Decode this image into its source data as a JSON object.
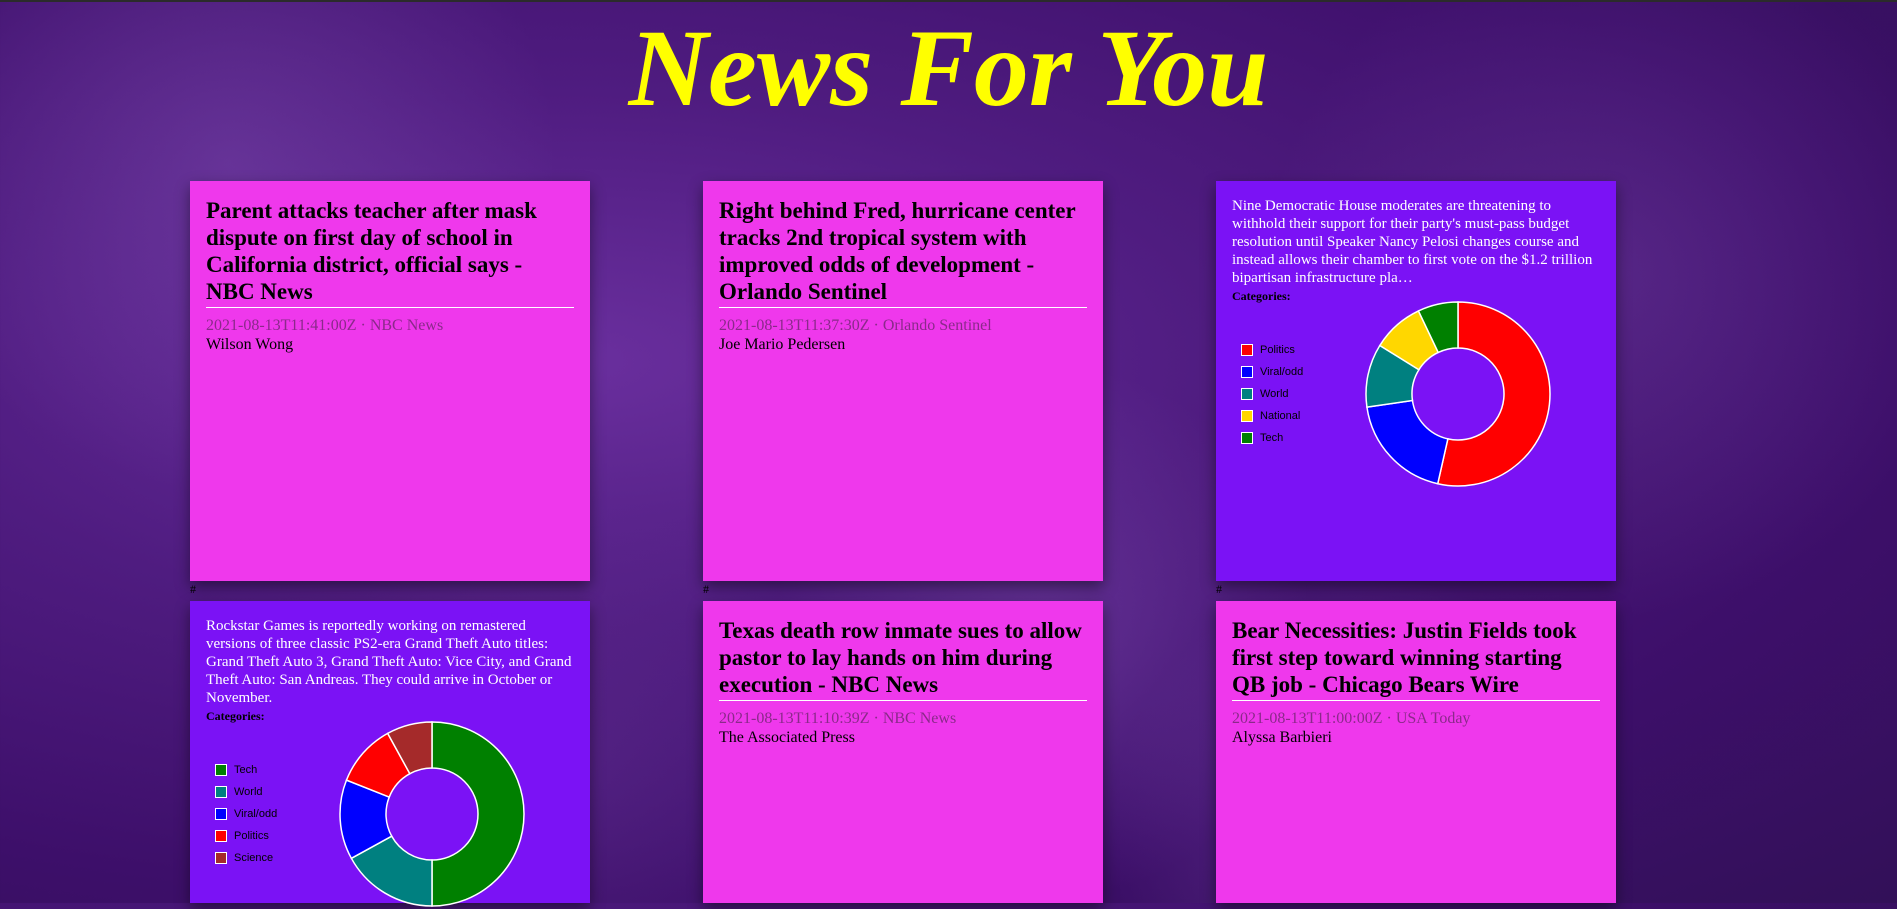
{
  "site": {
    "title": "News For You"
  },
  "cards": [
    {
      "type": "article",
      "headline": "Parent attacks teacher after mask dispute on first day of school in California district, official says - NBC News",
      "meta": "2021-08-13T11:41:00Z · NBC News",
      "author": "Wilson Wong"
    },
    {
      "type": "article",
      "headline": "Right behind Fred, hurricane center tracks 2nd tropical system with improved odds of development - Orlando Sentinel",
      "meta": "2021-08-13T11:37:30Z · Orlando Sentinel",
      "author": "Joe Mario Pedersen"
    },
    {
      "type": "summary",
      "summary": "Nine Democratic House moderates are threatening to withhold their support for their party's must-pass budget resolution until Speaker Nancy Pelosi changes course and instead allows their chamber to first vote on the $1.2 trillion bipartisan infrastructure pla…",
      "categories_label": "Categories:"
    },
    {
      "type": "summary",
      "summary": "Rockstar Games is reportedly working on remastered versions of three classic PS2-era Grand Theft Auto titles: Grand Theft Auto 3, Grand Theft Auto: Vice City, and Grand Theft Auto: San Andreas. They could arrive in October or November.",
      "categories_label": "Categories:"
    },
    {
      "type": "article",
      "headline": "Texas death row inmate sues to allow pastor to lay hands on him during execution - NBC News",
      "meta": "2021-08-13T11:10:39Z · NBC News",
      "author": "The Associated Press"
    },
    {
      "type": "article",
      "headline": "Bear Necessities: Justin Fields took first step toward winning starting QB job - Chicago Bears Wire",
      "meta": "2021-08-13T11:00:00Z · USA Today",
      "author": "Alyssa Barbieri"
    }
  ],
  "separators": [
    "#",
    "#",
    "#"
  ],
  "chart_data": [
    {
      "type": "pie",
      "donut": true,
      "legend_position": "left",
      "categories": [
        "Politics",
        "Viral/odd",
        "World",
        "National",
        "Tech"
      ],
      "values": [
        53,
        19,
        11,
        9,
        7
      ],
      "colors": [
        "#ff0000",
        "#0000ff",
        "#008080",
        "#ffd700",
        "#008000"
      ]
    },
    {
      "type": "pie",
      "donut": true,
      "legend_position": "left",
      "categories": [
        "Tech",
        "World",
        "Viral/odd",
        "Politics",
        "Science"
      ],
      "values": [
        50,
        17,
        14,
        11,
        8
      ],
      "colors": [
        "#008000",
        "#008080",
        "#0000ff",
        "#ff0000",
        "#a52a2a"
      ]
    }
  ]
}
